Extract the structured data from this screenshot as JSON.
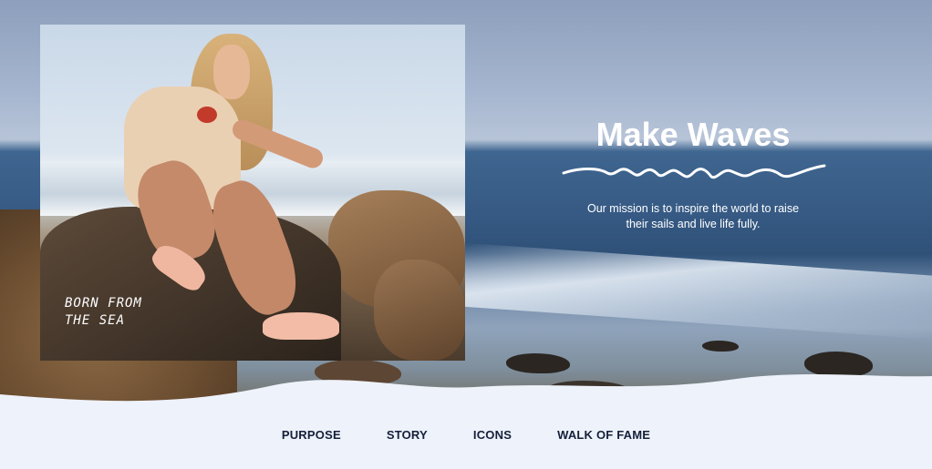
{
  "hero": {
    "photo_alt": "Woman sitting on rocks by the sea wearing pink shoes",
    "tagline_line1": "BORN FROM",
    "tagline_line2": "THE SEA",
    "headline": "Make Waves",
    "mission_line1": "Our mission is to inspire the world to raise",
    "mission_line2": "their sails and live life fully."
  },
  "nav": {
    "items": [
      {
        "label": "PURPOSE"
      },
      {
        "label": "STORY"
      },
      {
        "label": "ICONS"
      },
      {
        "label": "WALK OF FAME"
      }
    ]
  },
  "colors": {
    "page_background": "#eef2fa",
    "nav_text": "#14203a",
    "headline_text": "#ffffff"
  }
}
